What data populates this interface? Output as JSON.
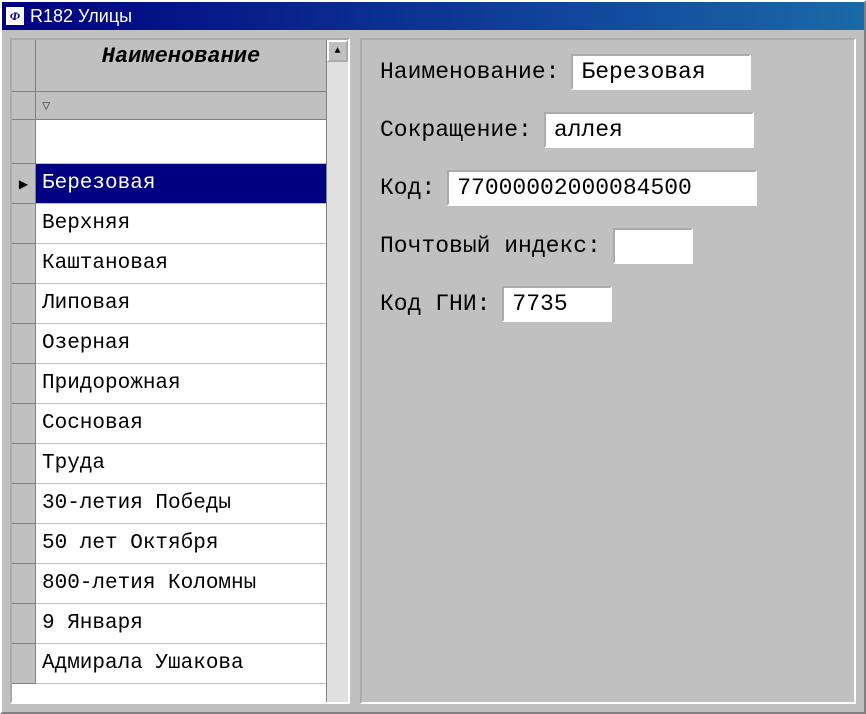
{
  "window": {
    "title": "R182 Улицы"
  },
  "grid": {
    "header": "Наименование",
    "rows": [
      "Березовая",
      "Верхняя",
      "Каштановая",
      "Липовая",
      "Озерная",
      "Придорожная",
      "Сосновая",
      "Труда",
      "30-летия Победы",
      "50 лет Октября",
      "800-летия Коломны",
      "9 Января",
      "Адмирала Ушакова"
    ],
    "selected_index": 0
  },
  "form": {
    "name_label": "Наименование:",
    "name_value": "Березовая",
    "abbr_label": "Сокращение:",
    "abbr_value": "аллея",
    "code_label": "Код:",
    "code_value": "77000002000084500",
    "postal_label": "Почтовый индекс:",
    "postal_value": "",
    "gni_label": "Код ГНИ:",
    "gni_value": "7735"
  }
}
